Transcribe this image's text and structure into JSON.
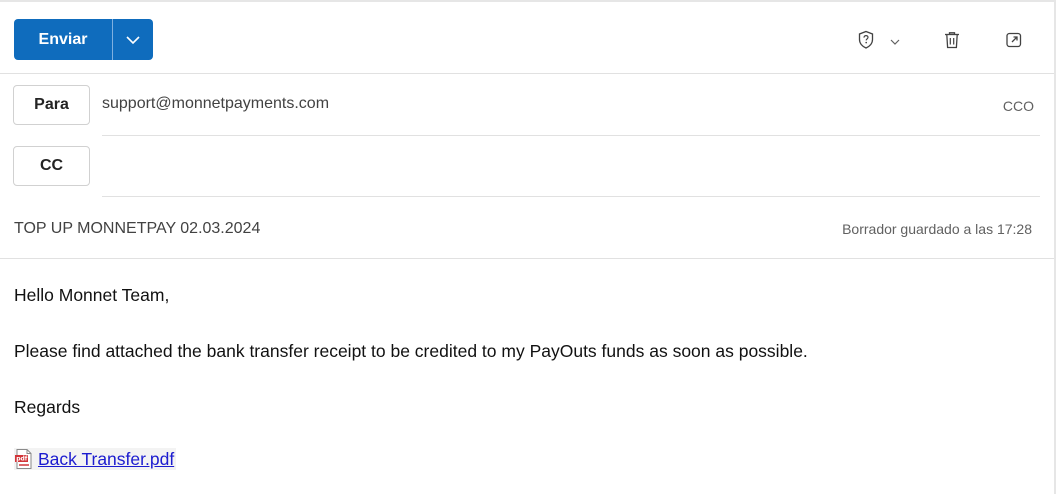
{
  "toolbar": {
    "send_label": "Enviar"
  },
  "recipients": {
    "to_label": "Para",
    "to_value": "support@monnetpayments.com",
    "bcc_label": "CCO",
    "cc_label": "CC"
  },
  "subject": "TOP UP MONNETPAY 02.03.2024",
  "draft_status": "Borrador guardado a las 17:28",
  "body": {
    "greeting": "Hello Monnet Team,",
    "paragraph": "Please find attached the bank transfer receipt to be credited to my PayOuts funds as soon as possible.",
    "closing": "Regards",
    "attachment_name": "Back Transfer.pdf"
  },
  "icons": {
    "sensitivity": "shield-question-icon",
    "dropdown": "chevron-down-icon",
    "delete": "trash-icon",
    "popout": "popout-icon",
    "pdf": "pdf-file-icon"
  },
  "colors": {
    "accent": "#0f6cbd",
    "link": "#1c1ccf"
  }
}
